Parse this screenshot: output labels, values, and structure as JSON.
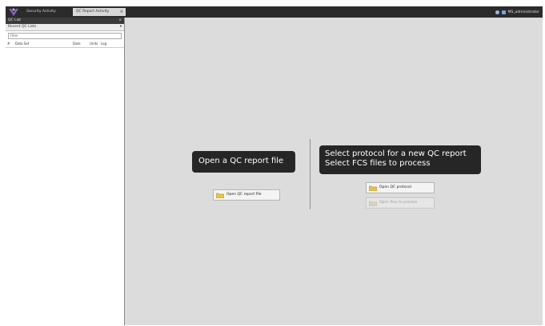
{
  "topbar": {
    "tabs": [
      {
        "label": "Security Activity"
      },
      {
        "label": "QC Report Activity",
        "close": "×"
      }
    ],
    "user_label": "MS_administrator"
  },
  "left_panel": {
    "header": "QC List",
    "header_close": "×",
    "sub_label": "Recent QC Lists",
    "sub_arrow": "▾",
    "filter_placeholder": "Filter",
    "columns": [
      "#",
      "Data Set",
      "Date",
      "Units",
      "Log"
    ]
  },
  "main": {
    "open_report_title": "Open a QC report file",
    "new_report_title_line1": "Select protocol for a new QC report",
    "new_report_title_line2": "Select FCS files to process",
    "open_report_button": "Open QC report file",
    "open_protocol_button": "Open QC protocol",
    "open_fcs_button": "Open files to process"
  },
  "colors": {
    "topbar": "#2b2b2b",
    "workspace": "#dcdcdc",
    "title_box": "#262626",
    "accent_logo": "#7a5bb0"
  }
}
